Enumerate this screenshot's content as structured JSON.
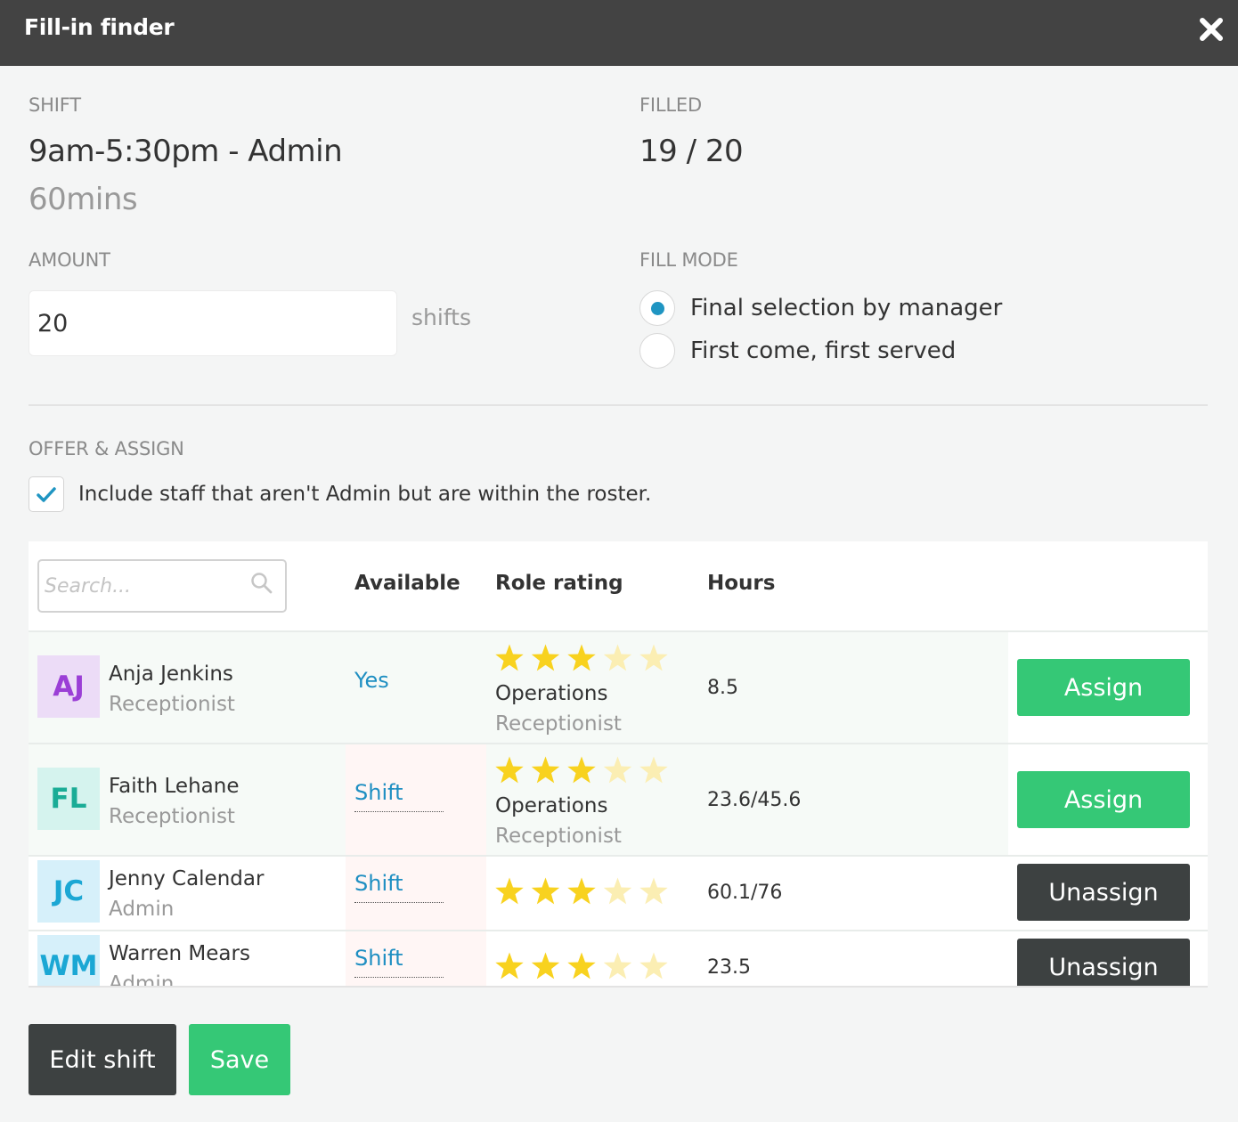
{
  "dialog": {
    "title": "Fill-in finder",
    "close_icon": "close-icon"
  },
  "shift": {
    "label": "SHIFT",
    "time_role": "9am-5:30pm - Admin",
    "break": "60mins"
  },
  "filled": {
    "label": "FILLED",
    "value": "19 / 20"
  },
  "amount": {
    "label": "AMOUNT",
    "value": "20",
    "suffix": "shifts"
  },
  "fill_mode": {
    "label": "FILL MODE",
    "options": [
      {
        "label": "Final selection by manager",
        "selected": true
      },
      {
        "label": "First come, first served",
        "selected": false
      }
    ]
  },
  "offer": {
    "label": "OFFER & ASSIGN",
    "include_label": "Include staff that aren't Admin but are within the roster.",
    "include_checked": true
  },
  "table": {
    "search_placeholder": "Search...",
    "columns": {
      "available": "Available",
      "role_rating": "Role rating",
      "hours": "Hours"
    },
    "rows": [
      {
        "initials": "AJ",
        "name": "Anja Jenkins",
        "role": "Receptionist",
        "available": "Yes",
        "rating": 3,
        "rating_role_type": "Operations",
        "rating_role": "Receptionist",
        "hours": "8.5",
        "action": "Assign",
        "avatar_bg": "#ecdcf7",
        "avatar_fg": "#9b3fd6"
      },
      {
        "initials": "FL",
        "name": "Faith Lehane",
        "role": "Receptionist",
        "available": "Shift",
        "rating": 3,
        "rating_role_type": "Operations",
        "rating_role": "Receptionist",
        "hours": "23.6/45.6",
        "action": "Assign",
        "avatar_bg": "#d5f3ee",
        "avatar_fg": "#1aac96"
      },
      {
        "initials": "JC",
        "name": "Jenny Calendar",
        "role": "Admin",
        "available": "Shift",
        "rating": 3,
        "hours": "60.1/76",
        "action": "Unassign",
        "avatar_bg": "#d6f0fa",
        "avatar_fg": "#1ba7d4"
      },
      {
        "initials": "WM",
        "name": "Warren Mears",
        "role": "Admin",
        "available": "Shift",
        "rating": 3,
        "hours": "23.5",
        "action": "Unassign",
        "avatar_bg": "#d6f0fa",
        "avatar_fg": "#1ba7d4"
      }
    ]
  },
  "footer": {
    "edit_label": "Edit shift",
    "save_label": "Save"
  },
  "colors": {
    "green": "#35c876",
    "dark": "#3d4141",
    "accent": "#1f95c2",
    "star": "#f8d21f",
    "star_empty": "#fbeeb3"
  }
}
